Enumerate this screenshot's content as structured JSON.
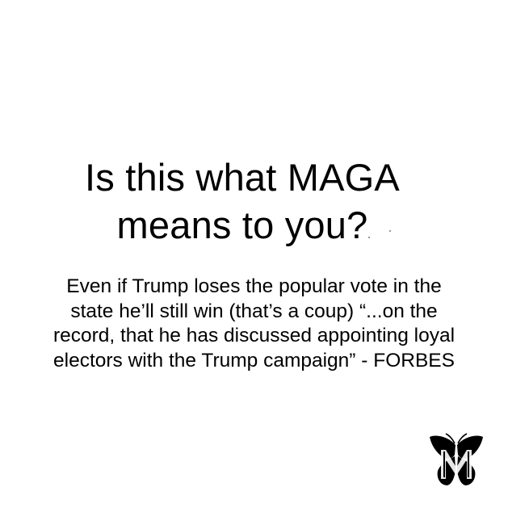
{
  "headline": {
    "line1": "Is this what MAGA",
    "line2": "means to you?"
  },
  "body": {
    "lines": [
      "Even if Trump loses the popular vote in the",
      "state he’ll still win (that’s a coup) “...on the",
      "record, that he has discussed appointing loyal",
      "electors with the Trump campaign” - FORBES"
    ]
  },
  "logo": {
    "icon": "butterfly-m-logo-icon",
    "color": "#000000"
  }
}
